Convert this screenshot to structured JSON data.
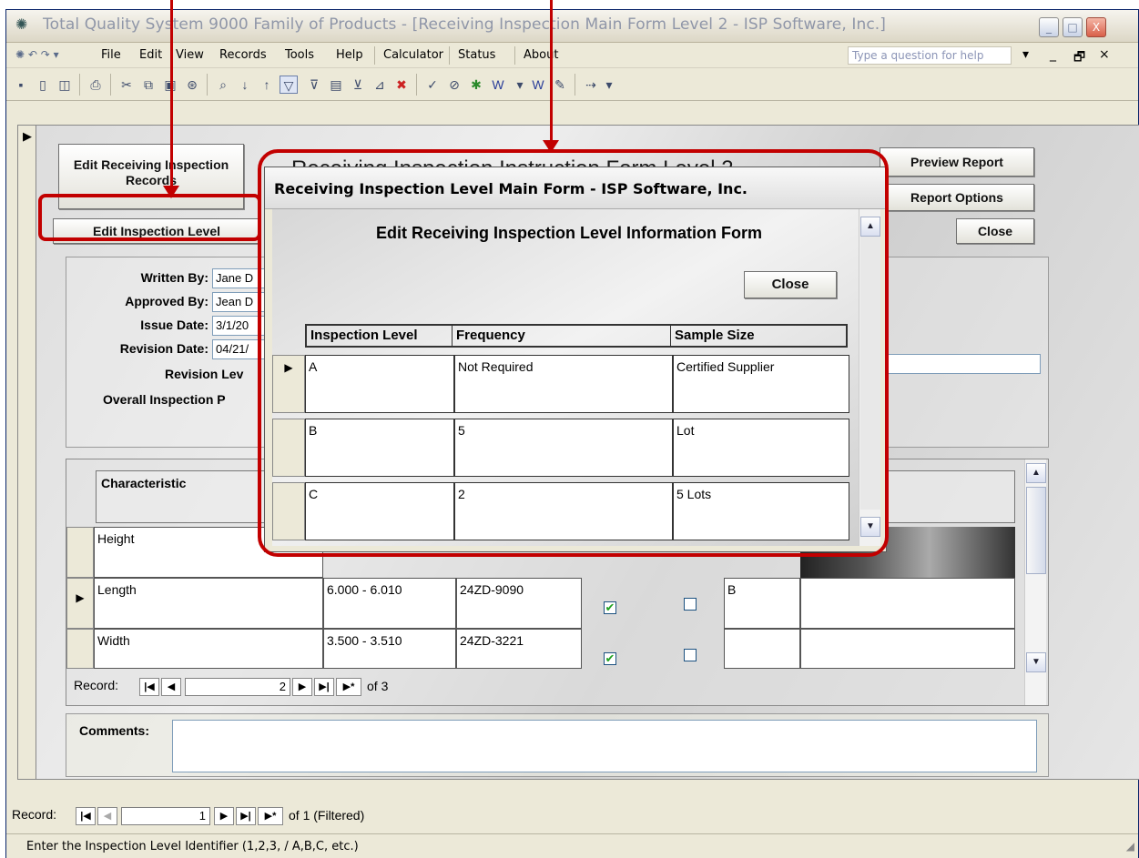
{
  "window": {
    "title": "Total Quality System 9000 Family of Products - [Receiving Inspection Main Form Level 2 - ISP Software, Inc.]",
    "icon": "app-icon",
    "controls": [
      "_",
      "□",
      "X"
    ]
  },
  "menu": {
    "items": [
      "File",
      "Edit",
      "View",
      "Records",
      "Tools",
      "Help",
      "Calculator",
      "Status",
      "About"
    ],
    "help_placeholder": "Type a question for help",
    "right_controls": [
      "▾",
      "_",
      "🗗",
      "×"
    ]
  },
  "toolbar": {
    "icons": [
      "save-icon",
      "design-view-icon",
      "print-preview-icon",
      "print-icon",
      "cut-icon",
      "copy-icon",
      "paste-icon",
      "format-painter-icon",
      "find-icon",
      "sort-ascending-icon",
      "sort-descending-icon",
      "filter-by-selection-icon",
      "filter-by-form-icon",
      "apply-filter-icon",
      "remove-filter-icon",
      "spelling-icon",
      "links-icon",
      "excel-icon",
      "word-icon",
      "word-merge-icon",
      "notes-icon",
      "new-object-icon"
    ]
  },
  "main_form": {
    "heading": "Receiving Inspection Instruction Form Level 2",
    "buttons": {
      "edit_records": "Edit Receiving Inspection Records",
      "edit_level": "Edit Inspection Level",
      "preview_report": "Preview Report",
      "report_options": "Report Options",
      "close": "Close"
    },
    "details": {
      "written_by_label": "Written By:",
      "written_by": "Jane D",
      "approved_by_label": "Approved By:",
      "approved_by": "Jean D",
      "issue_date_label": "Issue Date:",
      "issue_date": "3/1/20",
      "revision_date_label": "Revision Date:",
      "revision_date": "04/21/",
      "revision_level_label": "Revision Lev",
      "overall_label": "Overall Inspection P"
    },
    "characteristics": {
      "header": "Characteristic",
      "rows": [
        {
          "name": "Height",
          "spec": "",
          "gage": "",
          "check1": false,
          "check2": false,
          "level": "",
          "current": false
        },
        {
          "name": "Length",
          "spec": "6.000 - 6.010",
          "gage": "24ZD-9090",
          "check1": true,
          "check2": false,
          "level": "B",
          "current": true
        },
        {
          "name": "Width",
          "spec": "3.500 - 3.510",
          "gage": "24ZD-3221",
          "check1": true,
          "check2": false,
          "level": "",
          "current": false
        }
      ],
      "checked_symbol": "✔",
      "nav": {
        "label": "Record:",
        "current": "2",
        "total_text": "of 3",
        "buttons": [
          "|◀",
          "◀",
          "▶",
          "▶|",
          "▶*"
        ]
      }
    },
    "comments_label": "Comments:"
  },
  "popup": {
    "title": "Receiving Inspection Level Main Form - ISP Software, Inc.",
    "heading": "Edit Receiving Inspection Level Information Form",
    "close": "Close",
    "columns": [
      "Inspection Level",
      "Frequency",
      "Sample Size"
    ],
    "rows": [
      {
        "level": "A",
        "frequency": "Not Required",
        "sample": "Certified Supplier",
        "current": true
      },
      {
        "level": "B",
        "frequency": "5",
        "sample": "Lot",
        "current": false
      },
      {
        "level": "C",
        "frequency": "2",
        "sample": "5 Lots",
        "current": false
      }
    ]
  },
  "bottom_nav": {
    "label": "Record:",
    "current": "1",
    "total_text": "of 1 (Filtered)",
    "buttons": [
      "|◀",
      "◀",
      "▶",
      "▶|",
      "▶*"
    ]
  },
  "status": "Enter the Inspection Level Identifier (1,2,3, / A,B,C, etc.)",
  "colors": {
    "annotation": "#c20000",
    "window_chrome": "#ece9d8"
  }
}
